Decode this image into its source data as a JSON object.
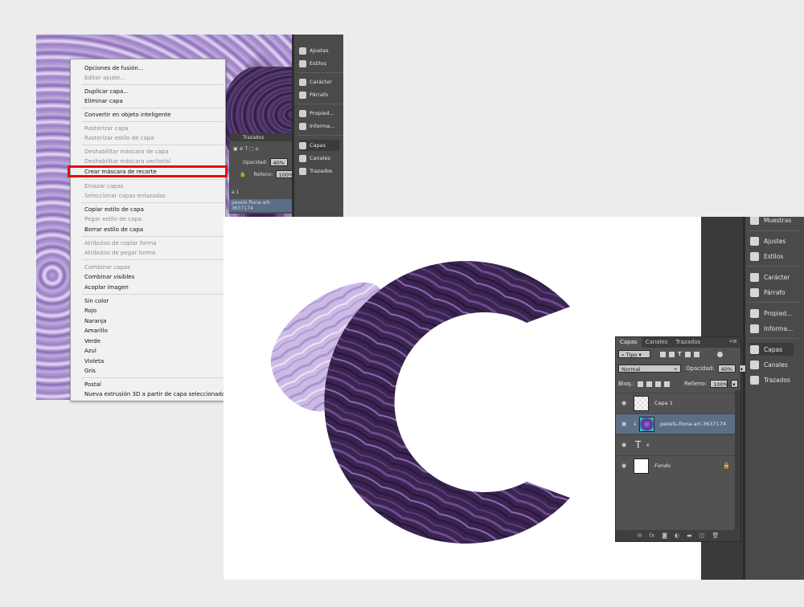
{
  "context_menu": {
    "items": [
      {
        "label": "Opciones de fusión...",
        "disabled": false
      },
      {
        "label": "Editar ajuste...",
        "disabled": true
      },
      {
        "label": "Duplicar capa...",
        "disabled": false
      },
      {
        "label": "Eliminar capa",
        "disabled": false
      },
      {
        "label": "Convertir en objeto inteligente",
        "disabled": false
      },
      {
        "label": "Rasterizar capa",
        "disabled": true
      },
      {
        "label": "Rasterizar estilo de capa",
        "disabled": true
      },
      {
        "label": "Deshabilitar máscara de capa",
        "disabled": true
      },
      {
        "label": "Deshabilitar máscara vectorial",
        "disabled": true
      },
      {
        "label": "Crear máscara de recorte",
        "disabled": false
      },
      {
        "label": "Enlazar capas",
        "disabled": true
      },
      {
        "label": "Seleccionar capas enlazadas",
        "disabled": true
      },
      {
        "label": "Copiar estilo de capa",
        "disabled": false
      },
      {
        "label": "Pegar estilo de capa",
        "disabled": true
      },
      {
        "label": "Borrar estilo de capa",
        "disabled": false
      },
      {
        "label": "Atributos de copiar forma",
        "disabled": true
      },
      {
        "label": "Atributos de pegar forma",
        "disabled": true
      },
      {
        "label": "Combinar capas",
        "disabled": true
      },
      {
        "label": "Combinar visibles",
        "disabled": false
      },
      {
        "label": "Acoplar imagen",
        "disabled": false
      },
      {
        "label": "Sin color",
        "disabled": false
      },
      {
        "label": "Rojo",
        "disabled": false
      },
      {
        "label": "Naranja",
        "disabled": false
      },
      {
        "label": "Amarillo",
        "disabled": false
      },
      {
        "label": "Verde",
        "disabled": false
      },
      {
        "label": "Azul",
        "disabled": false
      },
      {
        "label": "Violeta",
        "disabled": false
      },
      {
        "label": "Gris",
        "disabled": false
      },
      {
        "label": "Postal",
        "disabled": false
      },
      {
        "label": "Nueva extrusión 3D a partir de capa seleccionada",
        "disabled": false
      }
    ],
    "highlight_color": "#e01010"
  },
  "top_panel": {
    "items": [
      "Ajustes",
      "Estilos",
      "Carácter",
      "Párrafo",
      "Propied...",
      "Informa...",
      "Capas",
      "Canales",
      "Trazados"
    ],
    "tab_label": "Trazados",
    "opacity_label": "Opacidad:",
    "opacity_value": "40%",
    "fill_label": "Relleno:",
    "fill_value": "100%",
    "layer_1": "a 1",
    "layer_2": "pexels-fiona-art-3637174"
  },
  "right_dock": {
    "items": [
      "Muestras",
      "Ajustes",
      "Estilos",
      "Carácter",
      "Párrafo",
      "Propied...",
      "Informa...",
      "Capas",
      "Canales",
      "Trazados"
    ]
  },
  "layers_panel": {
    "tabs": [
      "Capas",
      "Canales",
      "Trazados"
    ],
    "menu_glyph": "»≡",
    "filter_label": "Tipo",
    "blend_mode": "Normal",
    "opacity_label": "Opacidad:",
    "opacity_value": "40%",
    "lock_label": "Bloq.:",
    "fill_label": "Relleno:",
    "fill_value": "100%",
    "layers": [
      {
        "name": "Capa 1"
      },
      {
        "name": "pexels-fiona-art-3637174"
      },
      {
        "name": "ε"
      },
      {
        "name": "Fondo"
      }
    ],
    "footer_icons": [
      "link-icon",
      "fx-icon",
      "mask-icon",
      "adjustment-icon",
      "folder-icon",
      "new-layer-icon",
      "trash-icon"
    ],
    "selected_color": "#5d6e87"
  },
  "colors": {
    "ui_dark": "#4a4a4a",
    "canvas": "#ffffff",
    "marble_dark": "#3a2552",
    "marble_light": "#b9a3d9"
  }
}
